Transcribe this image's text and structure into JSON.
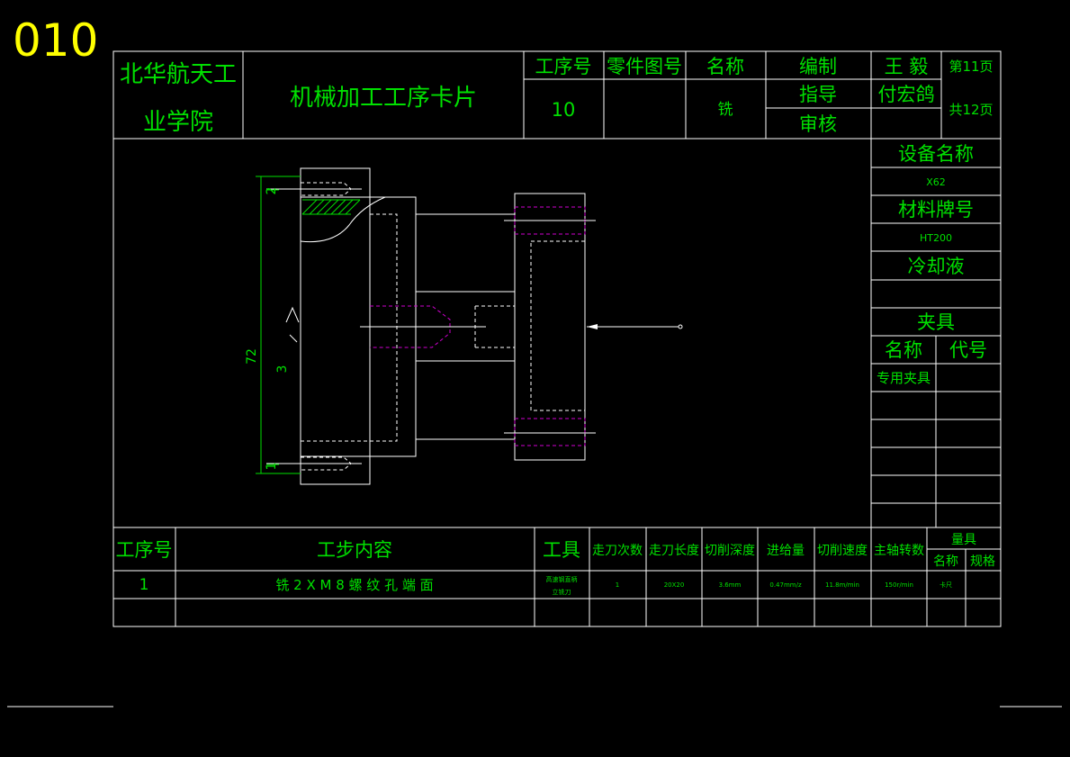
{
  "drawing_number": "010",
  "school": {
    "line1": "北华航天工",
    "line2": "业学院"
  },
  "card_title": "机械加工工序卡片",
  "header": {
    "process_no_label": "工序号",
    "part_drawing_no_label": "零件图号",
    "name_label": "名称",
    "process_no_value": "10",
    "name_value": "铣",
    "compile_label": "编制",
    "guide_label": "指导",
    "review_label": "审核",
    "compiler": "王 毅",
    "guide": "付宏鸽",
    "page_label": "第11页",
    "total_label": "共12页"
  },
  "side": {
    "equipment_label": "设备名称",
    "equipment_value": "X62",
    "material_label": "材料牌号",
    "material_value": "HT200",
    "coolant_label": "冷却液",
    "coolant_value": "",
    "fixture_label": "夹具",
    "fixture_name_label": "名称",
    "fixture_code_label": "代号",
    "fixture_name_value": "专用夹具"
  },
  "steps_header": {
    "step_no": "工序号",
    "content": "工步内容",
    "tool": "工具",
    "passes": "走刀次数",
    "length": "走刀长度",
    "depth": "切削深度",
    "feed": "进给量",
    "speed": "切削速度",
    "spindle": "主轴转数",
    "gauge": "量具",
    "gauge_name": "名称",
    "gauge_spec": "规格"
  },
  "steps": [
    {
      "no": "1",
      "content": "铣 2 X M 8 螺 纹 孔 端 面",
      "tool_line1": "高速钢直柄",
      "tool_line2": "立铣刀",
      "passes": "1",
      "length": "20X20",
      "depth": "3.6mm",
      "feed": "0.47mm/z",
      "speed": "11.8m/min",
      "spindle": "150r/min",
      "gauge_name": "卡尺",
      "gauge_spec": ""
    }
  ],
  "drawing": {
    "dim_72": "72",
    "label_1": "1",
    "label_2": "2",
    "label_3": "3"
  }
}
